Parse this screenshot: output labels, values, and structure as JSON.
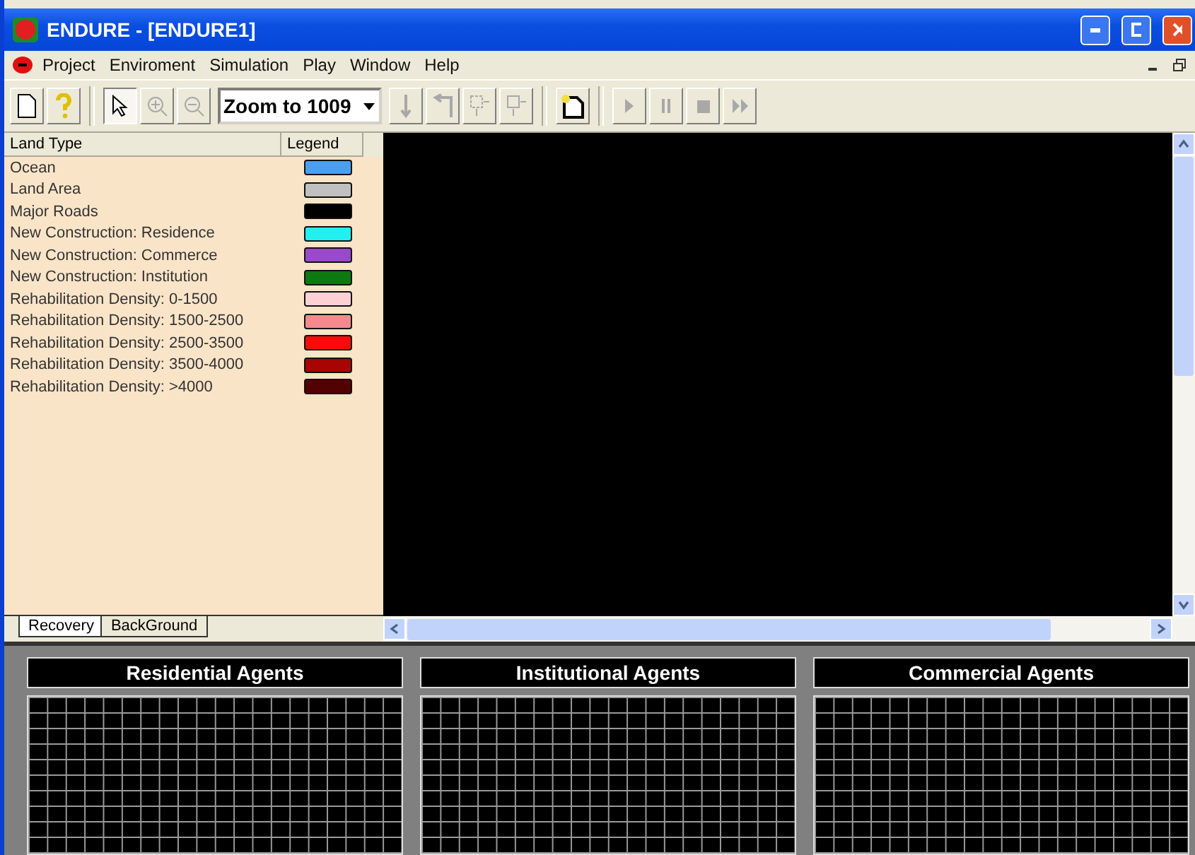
{
  "window": {
    "title": "ENDURE - [ENDURE1]"
  },
  "menu": [
    "Project",
    "Enviroment",
    "Simulation",
    "Play",
    "Window",
    "Help"
  ],
  "toolbar": [
    {
      "kind": "new",
      "disabled": false,
      "pressed": false
    },
    {
      "kind": "help",
      "disabled": false,
      "pressed": false
    },
    {
      "kind": "sep"
    },
    {
      "kind": "pointer",
      "disabled": false,
      "pressed": true
    },
    {
      "kind": "zoom-in",
      "disabled": true,
      "pressed": false
    },
    {
      "kind": "zoom-out",
      "disabled": true,
      "pressed": false
    },
    {
      "kind": "zoom",
      "value": "Zoom to 1009"
    },
    {
      "kind": "down",
      "disabled": true,
      "pressed": false
    },
    {
      "kind": "back",
      "disabled": true,
      "pressed": false
    },
    {
      "kind": "move-a",
      "disabled": true,
      "pressed": false
    },
    {
      "kind": "move-b",
      "disabled": true,
      "pressed": false
    },
    {
      "kind": "sep"
    },
    {
      "kind": "new-map",
      "disabled": false,
      "pressed": false
    },
    {
      "kind": "sep"
    },
    {
      "kind": "play",
      "disabled": true,
      "pressed": false
    },
    {
      "kind": "pause",
      "disabled": true,
      "pressed": false
    },
    {
      "kind": "stop",
      "disabled": true,
      "pressed": false
    },
    {
      "kind": "fast",
      "disabled": true,
      "pressed": false
    }
  ],
  "legend": {
    "columns": [
      "Land Type",
      "Legend"
    ],
    "rows": [
      {
        "label": "Ocean",
        "color": "#4a9ff0"
      },
      {
        "label": "Land Area",
        "color": "#c0c0c0"
      },
      {
        "label": "Major Roads",
        "color": "#000000"
      },
      {
        "label": "New Construction: Residence",
        "color": "#22f0f0"
      },
      {
        "label": "New Construction: Commerce",
        "color": "#9a48cc"
      },
      {
        "label": "New Construction: Institution",
        "color": "#0c7a10"
      },
      {
        "label": "Rehabilitation Density: 0-1500",
        "color": "#fdd0d4"
      },
      {
        "label": "Rehabilitation Density: 1500-2500",
        "color": "#f48a8c"
      },
      {
        "label": "Rehabilitation Density: 2500-3500",
        "color": "#fa0a0a"
      },
      {
        "label": "Rehabilitation Density: 3500-4000",
        "color": "#a80404"
      },
      {
        "label": "Rehabilitation Density: >4000",
        "color": "#520202"
      }
    ]
  },
  "tabs": [
    {
      "label": "Recovery",
      "selected": true
    },
    {
      "label": "BackGround",
      "selected": false
    }
  ],
  "agents": [
    "Residential Agents",
    "Institutional Agents",
    "Commercial Agents"
  ]
}
